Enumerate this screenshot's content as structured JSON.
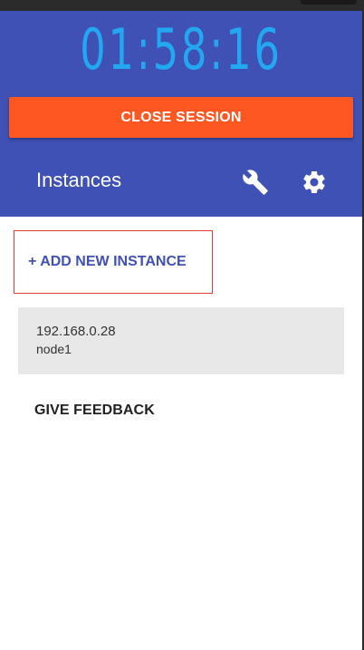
{
  "session": {
    "timer": "01:58:16",
    "close_label": "CLOSE SESSION"
  },
  "sidebar": {
    "title": "Instances",
    "tools": [
      {
        "icon": "wrench-icon"
      },
      {
        "icon": "gear-icon"
      }
    ],
    "add_instance_label": "+ ADD NEW INSTANCE",
    "instances": [
      {
        "ip": "192.168.0.28",
        "name": "node1"
      }
    ],
    "feedback_label": "GIVE FEEDBACK"
  },
  "colors": {
    "header_bg": "#3f51b5",
    "timer": "#22a7f0",
    "close_button": "#ff5722",
    "accent_text": "#3f51b5",
    "highlight_border": "#e53935",
    "instance_bg": "#e8e8e8"
  }
}
